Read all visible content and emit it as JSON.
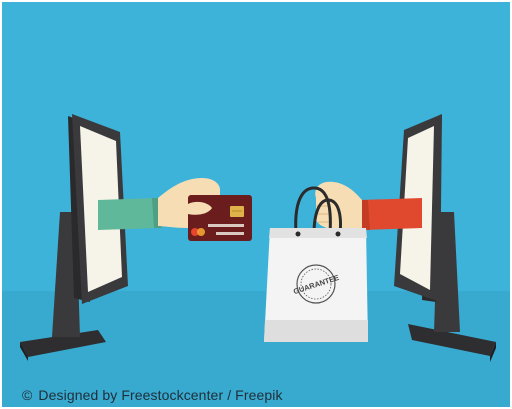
{
  "illustration": {
    "bag_stamp_text": "GUARANTEE",
    "credit": {
      "symbol": "©",
      "text": "Designed by Freestockcenter / Freepik"
    },
    "colors": {
      "background": "#3db3da",
      "monitor": "#3a3a3c",
      "screen": "#f6f3e9",
      "card": "#6b1d1d",
      "left_sleeve": "#5fb89a",
      "right_sleeve": "#e0492e",
      "skin": "#f6ddb3",
      "bag": "#f4f4f4"
    }
  }
}
